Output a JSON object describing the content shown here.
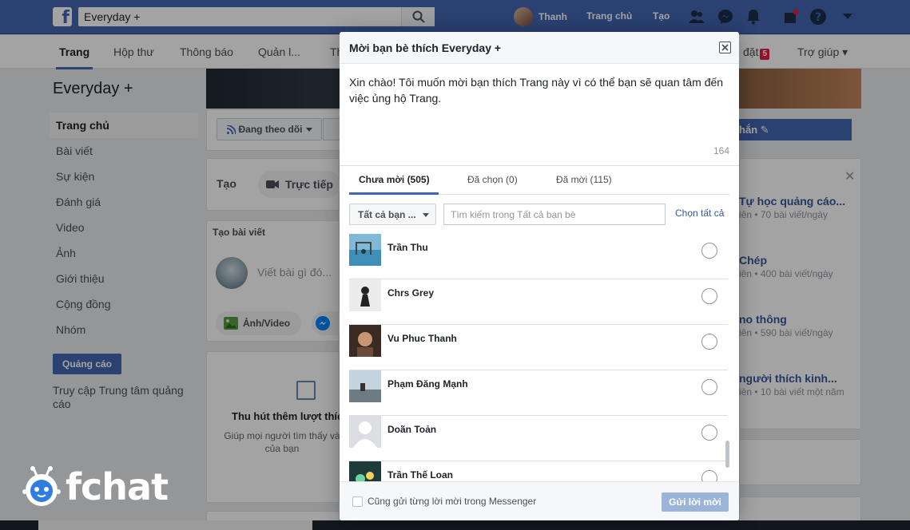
{
  "topbar": {
    "search_value": "Everyday +",
    "profile_name": "Thanh",
    "home_link": "Trang chủ",
    "create_link": "Tạo"
  },
  "page_tabs": [
    {
      "label": "Trang"
    },
    {
      "label": "Hộp thư"
    },
    {
      "label": "Thông báo"
    },
    {
      "label": "Quản l..."
    },
    {
      "label": "Th"
    },
    {
      "label": "đặt",
      "badge": "5"
    },
    {
      "label": "Trợ giúp ▾"
    }
  ],
  "left_nav": {
    "page_name": "Everyday +",
    "items": [
      {
        "label": "Trang chủ"
      },
      {
        "label": "Bài viết"
      },
      {
        "label": "Sự kiện"
      },
      {
        "label": "Đánh giá"
      },
      {
        "label": "Video"
      },
      {
        "label": "Ảnh"
      },
      {
        "label": "Giới thiệu"
      },
      {
        "label": "Cộng đồng"
      },
      {
        "label": "Nhóm"
      }
    ],
    "ad_button": "Quảng cáo",
    "ad_center_link": "Truy cập Trung tâm quảng cáo"
  },
  "main_bg": {
    "follow_button": "Đang theo dõi",
    "create_label": "Tạo",
    "live_button": "Trực tiếp",
    "create_post_header": "Tạo bài viết",
    "post_placeholder": "Viết bài gì đó...",
    "photo_video_button": "Ảnh/Video",
    "promo_title": "Thu hút thêm lượt thíc",
    "promo_desc": "Giúp mọi người tìm thấy và của bạn"
  },
  "right_bg": {
    "blue_button": "hắn",
    "suggestions": [
      {
        "title": "Tự học quảng cáo...",
        "sub": "iên • 70 bài viết/ngày"
      },
      {
        "title": "Chép",
        "sub": "iên • 400 bài viết/ngày"
      },
      {
        "title": "no thông",
        "sub": "iên • 590 bài viết/ngày"
      },
      {
        "title": "người thích kinh...",
        "sub": "iên • 10 bài viết một năm"
      }
    ]
  },
  "watermark": {
    "text": "fchat"
  },
  "modal": {
    "title": "Mời bạn bè thích Everyday +",
    "message": "Xin chào! Tôi muốn mời bạn thích Trang này vì có thể bạn sẽ quan tâm đến việc ủng hộ Trang.",
    "char_count": "164",
    "tabs": [
      {
        "label": "Chưa mời (505)"
      },
      {
        "label": "Đã chọn (0)"
      },
      {
        "label": "Đã mời (115)"
      }
    ],
    "filter_select": "Tất cả bạn ...",
    "search_placeholder": "Tìm kiếm trong Tất cả bạn bè",
    "select_all": "Chọn tất cả",
    "friends": [
      {
        "name": "Trần Thu"
      },
      {
        "name": "Chrs Grey"
      },
      {
        "name": "Vu Phuc Thanh"
      },
      {
        "name": "Phạm Đăng Mạnh"
      },
      {
        "name": "Doãn Toản"
      },
      {
        "name": "Trần Thế Loan"
      }
    ],
    "messenger_checkbox_label": "Cũng gửi từng lời mời trong Messenger",
    "send_button": "Gửi lời mời"
  }
}
